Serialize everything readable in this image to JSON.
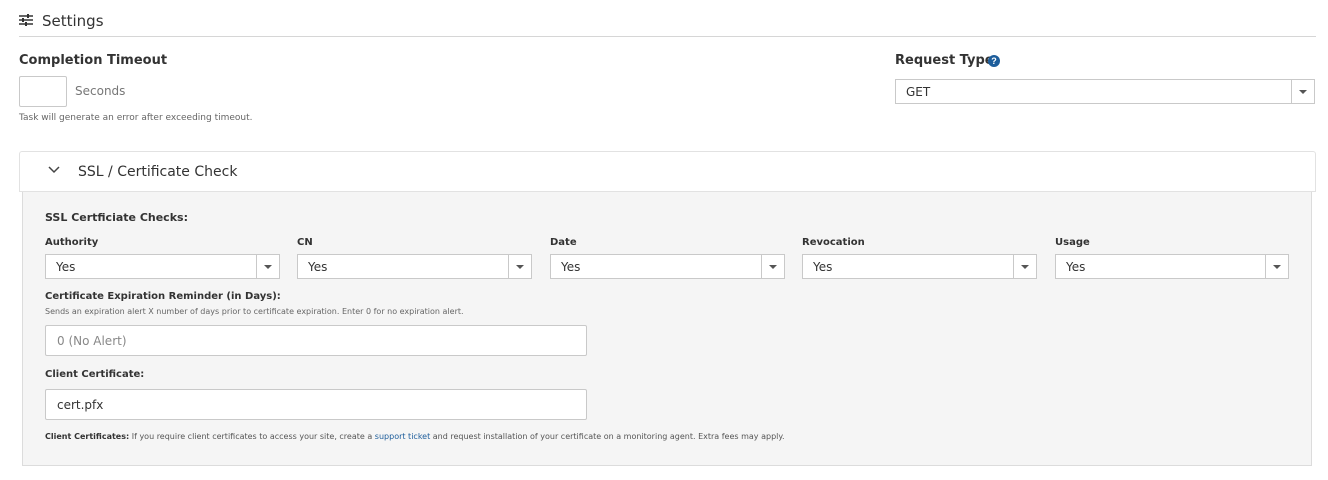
{
  "settings": {
    "title": "Settings",
    "icon": "sliders-icon"
  },
  "completion_timeout": {
    "label": "Completion Timeout",
    "value": "",
    "unit": "Seconds",
    "hint": "Task will generate an error after exceeding timeout."
  },
  "request_type": {
    "label": "Request Type",
    "help_icon": "?",
    "selected": "GET"
  },
  "ssl_panel": {
    "title": "SSL / Certificate Check",
    "checks_heading": "SSL Certficiate Checks:",
    "checks": [
      {
        "label": "Authority",
        "selected": "Yes"
      },
      {
        "label": "CN",
        "selected": "Yes"
      },
      {
        "label": "Date",
        "selected": "Yes"
      },
      {
        "label": "Revocation",
        "selected": "Yes"
      },
      {
        "label": "Usage",
        "selected": "Yes"
      }
    ],
    "expiration": {
      "label": "Certificate Expiration Reminder (in Days):",
      "description": "Sends an expiration alert X number of days prior to certificate expiration. Enter 0 for no expiration alert.",
      "placeholder": "0 (No Alert)"
    },
    "client_certificate": {
      "label": "Client Certificate:",
      "value": "cert.pfx"
    },
    "note": {
      "prefix": "Client Certificates:",
      "text_before": " If you require client certificates to access your site, create a ",
      "link": "support ticket",
      "text_after": " and request installation of your certificate on a monitoring agent. Extra fees may apply."
    }
  },
  "colors": {
    "accent": "#1d5d9b",
    "panel_bg": "#f5f5f5",
    "border": "#c9c9c9"
  }
}
